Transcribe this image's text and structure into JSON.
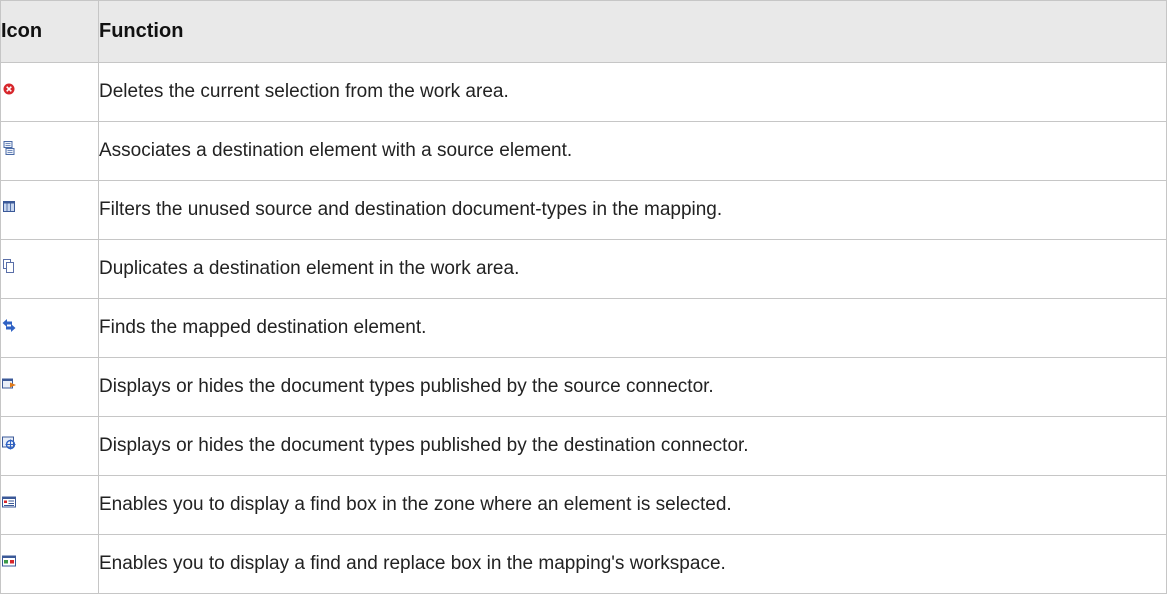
{
  "table": {
    "headers": {
      "icon": "Icon",
      "function": "Function"
    },
    "rows": [
      {
        "icon": "delete-icon",
        "function": "Deletes the current selection from the work area."
      },
      {
        "icon": "associate-icon",
        "function": "Associates a destination element with a source element."
      },
      {
        "icon": "filter-icon",
        "function": "Filters the unused source and destination document-types in the mapping."
      },
      {
        "icon": "duplicate-icon",
        "function": "Duplicates a destination element in the work area."
      },
      {
        "icon": "find-mapped-icon",
        "function": "Finds the mapped destination element."
      },
      {
        "icon": "source-connector-icon",
        "function": "Displays or hides the document types published by the source connector."
      },
      {
        "icon": "destination-connector-icon",
        "function": "Displays or hides the document types published by the destination connector."
      },
      {
        "icon": "find-box-icon",
        "function": "Enables you to display a find box in the zone where an element is selected."
      },
      {
        "icon": "find-replace-icon",
        "function": "Enables you to display a find and replace box in the mapping's workspace."
      }
    ]
  }
}
